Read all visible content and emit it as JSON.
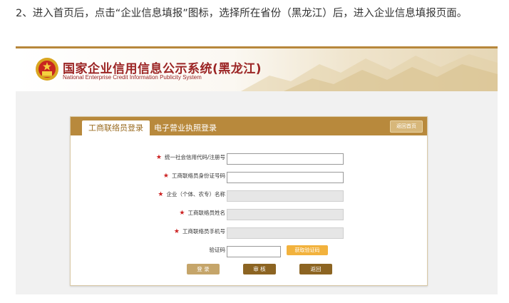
{
  "article": {
    "intro": "2、进入首页后，点击“企业信息填报”图标，选择所在省份（黑龙江）后，进入企业信息填报页面。"
  },
  "header": {
    "title_main": "国家企业信用信息公示系统",
    "title_province": "(黑龙江)",
    "subtitle": "National Enterprise Credit Information Publicity System"
  },
  "login": {
    "tabs": [
      {
        "label": "工商联络员登录",
        "active": true
      },
      {
        "label": "电子营业执照登录",
        "active": false
      }
    ],
    "home_button": "返回首页",
    "fields": [
      {
        "label": "统一社会信用代码/注册号",
        "required": true,
        "value": "",
        "enabled": true
      },
      {
        "label": "工商联络员身份证号码",
        "required": true,
        "value": "",
        "enabled": true
      },
      {
        "label": "企业（个体、农专）名称",
        "required": true,
        "value": "",
        "enabled": false
      },
      {
        "label": "工商联络员姓名",
        "required": true,
        "value": "",
        "enabled": false
      },
      {
        "label": "工商联络员手机号",
        "required": true,
        "value": "",
        "enabled": false
      }
    ],
    "captcha": {
      "label": "验证码",
      "value": "",
      "get_code_button": "获取验证码"
    },
    "buttons": {
      "login": "登 录",
      "audit": "审 核",
      "back": "返回"
    }
  },
  "colors": {
    "accent": "#b8893c",
    "title_red": "#9b2424",
    "required_star": "#cc2222",
    "captcha_button": "#f2b23d"
  }
}
